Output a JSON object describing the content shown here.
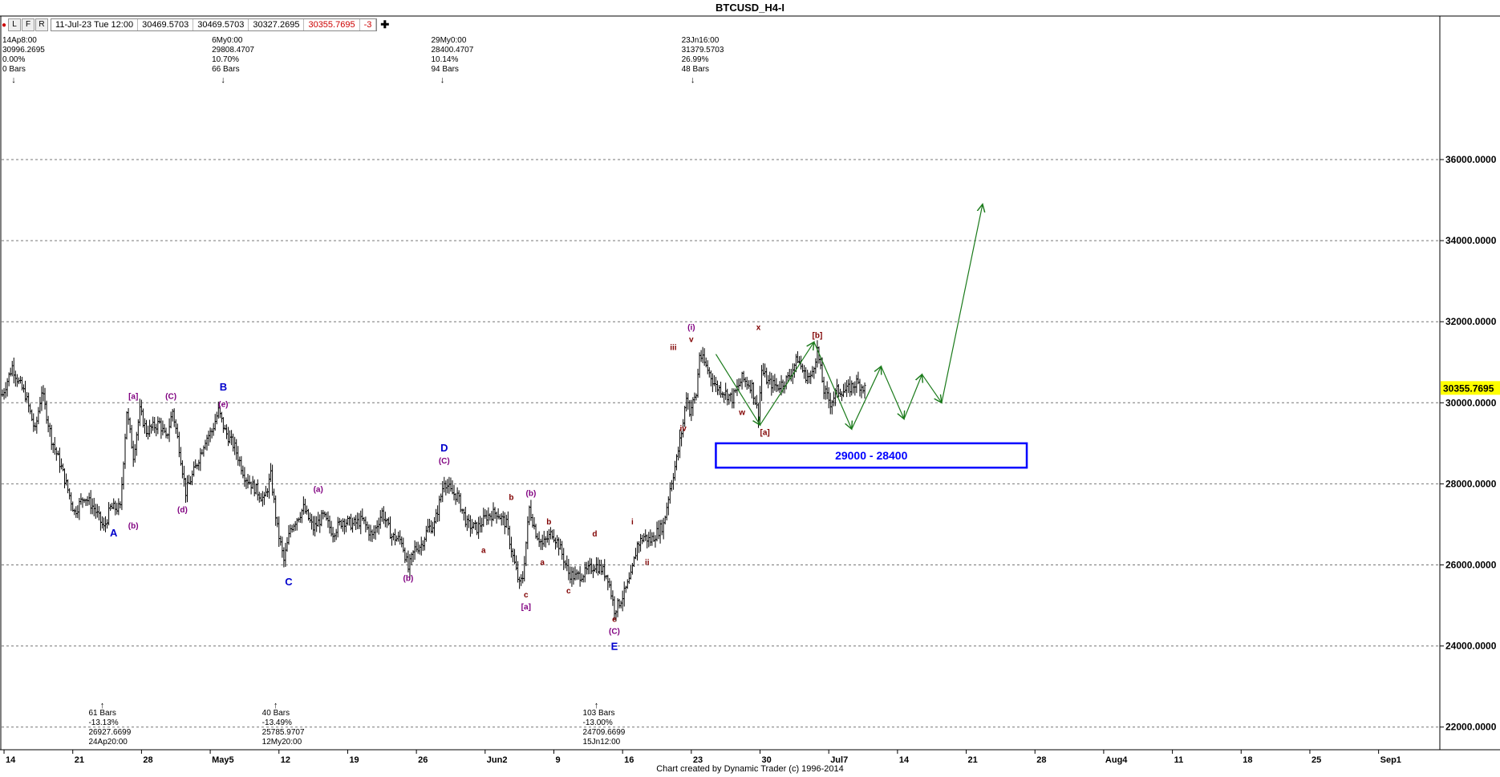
{
  "window": {
    "title": "BTCUSD_H4-I",
    "toolbar": {
      "buttons": [
        "L",
        "F",
        "R"
      ],
      "date": "11-Jul-23 Tue 12:00",
      "open": "30469.5703",
      "high": "30469.5703",
      "low": "30327.2695",
      "close": "30355.7695",
      "change": "-3"
    },
    "credit": "Chart created by Dynamic Trader  (c) 1996-2014"
  },
  "colors": {
    "up_arrow": "#1a7a1a",
    "target_box": "#0000ff",
    "wave_blue": "#0000cc",
    "wave_purple": "#800080",
    "wave_maroon": "#800000",
    "price_box": "#ffff00"
  },
  "chart_data": {
    "type": "ohlc",
    "title": "BTCUSD_H4-I",
    "ylim": [
      21500,
      37800
    ],
    "y_ticks": [
      22000,
      24000,
      26000,
      28000,
      30000,
      32000,
      34000,
      36000
    ],
    "y_tick_labels": [
      "22000.0000",
      "24000.0000",
      "26000.0000",
      "28000.0000",
      "30000.0000",
      "32000.0000",
      "34000.0000",
      "36000.0000"
    ],
    "x_ticks": [
      {
        "label": "14",
        "bar": 1
      },
      {
        "label": "21",
        "bar": 43
      },
      {
        "label": "28",
        "bar": 85
      },
      {
        "label": "May5",
        "bar": 127
      },
      {
        "label": "12",
        "bar": 169
      },
      {
        "label": "19",
        "bar": 211
      },
      {
        "label": "26",
        "bar": 253
      },
      {
        "label": "Jun2",
        "bar": 295
      },
      {
        "label": "9",
        "bar": 337
      },
      {
        "label": "16",
        "bar": 379
      },
      {
        "label": "23",
        "bar": 421
      },
      {
        "label": "30",
        "bar": 463
      },
      {
        "label": "Jul7",
        "bar": 505
      },
      {
        "label": "14",
        "bar": 547
      },
      {
        "label": "21",
        "bar": 589
      },
      {
        "label": "28",
        "bar": 631
      },
      {
        "label": "Aug4",
        "bar": 673
      },
      {
        "label": "11",
        "bar": 715
      },
      {
        "label": "18",
        "bar": 757
      },
      {
        "label": "25",
        "bar": 799
      },
      {
        "label": "Sep1",
        "bar": 841
      }
    ],
    "last_bar": 527,
    "current_price": "30355.7695",
    "path": [
      [
        0,
        30200
      ],
      [
        6,
        30900
      ],
      [
        10,
        30500
      ],
      [
        14,
        30200
      ],
      [
        20,
        29300
      ],
      [
        24,
        30300
      ],
      [
        30,
        29100
      ],
      [
        36,
        28400
      ],
      [
        44,
        27300
      ],
      [
        50,
        27700
      ],
      [
        56,
        27400
      ],
      [
        62,
        26900
      ],
      [
        66,
        27400
      ],
      [
        72,
        27400
      ],
      [
        76,
        29800
      ],
      [
        80,
        28700
      ],
      [
        84,
        29800
      ],
      [
        88,
        29300
      ],
      [
        96,
        29500
      ],
      [
        100,
        29100
      ],
      [
        104,
        29800
      ],
      [
        108,
        28900
      ],
      [
        112,
        27800
      ],
      [
        118,
        28400
      ],
      [
        124,
        29100
      ],
      [
        128,
        29300
      ],
      [
        132,
        29800
      ],
      [
        136,
        29300
      ],
      [
        142,
        28900
      ],
      [
        148,
        28200
      ],
      [
        154,
        27900
      ],
      [
        160,
        27600
      ],
      [
        164,
        28200
      ],
      [
        168,
        26900
      ],
      [
        172,
        26100
      ],
      [
        176,
        26900
      ],
      [
        184,
        27400
      ],
      [
        190,
        26900
      ],
      [
        196,
        27200
      ],
      [
        202,
        26800
      ],
      [
        208,
        27100
      ],
      [
        214,
        27000
      ],
      [
        220,
        27100
      ],
      [
        226,
        26700
      ],
      [
        232,
        27300
      ],
      [
        238,
        26700
      ],
      [
        244,
        26600
      ],
      [
        248,
        25900
      ],
      [
        252,
        26400
      ],
      [
        256,
        26500
      ],
      [
        260,
        26900
      ],
      [
        264,
        27000
      ],
      [
        268,
        27700
      ],
      [
        270,
        28100
      ],
      [
        274,
        27800
      ],
      [
        278,
        27700
      ],
      [
        284,
        27000
      ],
      [
        290,
        26900
      ],
      [
        296,
        27200
      ],
      [
        302,
        27300
      ],
      [
        308,
        27000
      ],
      [
        312,
        26200
      ],
      [
        316,
        25500
      ],
      [
        318,
        25700
      ],
      [
        322,
        27400
      ],
      [
        326,
        26800
      ],
      [
        330,
        26500
      ],
      [
        336,
        26800
      ],
      [
        340,
        26500
      ],
      [
        346,
        25800
      ],
      [
        350,
        25700
      ],
      [
        356,
        25800
      ],
      [
        362,
        26000
      ],
      [
        366,
        25900
      ],
      [
        370,
        25700
      ],
      [
        372,
        25300
      ],
      [
        374,
        24900
      ],
      [
        376,
        25000
      ],
      [
        380,
        25300
      ],
      [
        384,
        25700
      ],
      [
        388,
        26500
      ],
      [
        392,
        26700
      ],
      [
        396,
        26600
      ],
      [
        400,
        26800
      ],
      [
        404,
        27000
      ],
      [
        408,
        27900
      ],
      [
        412,
        28600
      ],
      [
        416,
        29500
      ],
      [
        418,
        30200
      ],
      [
        420,
        29800
      ],
      [
        424,
        30200
      ],
      [
        426,
        31200
      ],
      [
        430,
        30900
      ],
      [
        436,
        30400
      ],
      [
        440,
        30300
      ],
      [
        446,
        30100
      ],
      [
        452,
        30600
      ],
      [
        458,
        30400
      ],
      [
        462,
        29700
      ],
      [
        464,
        30800
      ],
      [
        468,
        30500
      ],
      [
        474,
        30400
      ],
      [
        480,
        30600
      ],
      [
        486,
        31100
      ],
      [
        490,
        30700
      ],
      [
        494,
        30600
      ],
      [
        498,
        31300
      ],
      [
        502,
        30300
      ],
      [
        506,
        30000
      ],
      [
        510,
        30300
      ],
      [
        516,
        30300
      ],
      [
        522,
        30500
      ],
      [
        527,
        30355
      ]
    ],
    "projection": [
      [
        436,
        31200
      ],
      [
        463,
        29450
      ],
      [
        496,
        31500
      ],
      [
        519,
        29350
      ],
      [
        537,
        30900
      ],
      [
        551,
        29600
      ],
      [
        562,
        30700
      ],
      [
        574,
        30000
      ],
      [
        599,
        34900
      ]
    ],
    "target_box": {
      "label": "29000 - 28400",
      "from_bar": 436,
      "to_bar": 626,
      "high": 29000,
      "low": 28400
    },
    "wave_labels": [
      {
        "text": "A",
        "bar": 68,
        "price": 26700,
        "color": "blue"
      },
      {
        "text": "B",
        "bar": 135,
        "price": 30300,
        "color": "blue"
      },
      {
        "text": "C",
        "bar": 175,
        "price": 25500,
        "color": "blue"
      },
      {
        "text": "D",
        "bar": 270,
        "price": 28800,
        "color": "blue"
      },
      {
        "text": "E",
        "bar": 374,
        "price": 23900,
        "color": "blue"
      },
      {
        "text": "[a]",
        "bar": 80,
        "price": 30100,
        "color": "purple"
      },
      {
        "text": "(b)",
        "bar": 80,
        "price": 26900,
        "color": "purple"
      },
      {
        "text": "(C)",
        "bar": 103,
        "price": 30100,
        "color": "purple"
      },
      {
        "text": "(d)",
        "bar": 110,
        "price": 27300,
        "color": "purple"
      },
      {
        "text": "(e)",
        "bar": 135,
        "price": 29900,
        "color": "purple"
      },
      {
        "text": "(a)",
        "bar": 193,
        "price": 27800,
        "color": "purple"
      },
      {
        "text": "(b)",
        "bar": 248,
        "price": 25600,
        "color": "purple"
      },
      {
        "text": "(C)",
        "bar": 270,
        "price": 28500,
        "color": "purple"
      },
      {
        "text": "(b)",
        "bar": 323,
        "price": 27700,
        "color": "purple"
      },
      {
        "text": "[a]",
        "bar": 320,
        "price": 24900,
        "color": "purple"
      },
      {
        "text": "(C)",
        "bar": 374,
        "price": 24300,
        "color": "purple"
      },
      {
        "text": "(i)",
        "bar": 421,
        "price": 31800,
        "color": "purple"
      },
      {
        "text": "b",
        "bar": 311,
        "price": 27600,
        "color": "maroon"
      },
      {
        "text": "a",
        "bar": 294,
        "price": 26300,
        "color": "maroon"
      },
      {
        "text": "c",
        "bar": 320,
        "price": 25200,
        "color": "maroon"
      },
      {
        "text": "a",
        "bar": 330,
        "price": 26000,
        "color": "maroon"
      },
      {
        "text": "b",
        "bar": 334,
        "price": 27000,
        "color": "maroon"
      },
      {
        "text": "c",
        "bar": 346,
        "price": 25300,
        "color": "maroon"
      },
      {
        "text": "d",
        "bar": 362,
        "price": 26700,
        "color": "maroon"
      },
      {
        "text": "e",
        "bar": 374,
        "price": 24600,
        "color": "maroon"
      },
      {
        "text": "i",
        "bar": 385,
        "price": 27000,
        "color": "maroon"
      },
      {
        "text": "ii",
        "bar": 394,
        "price": 26000,
        "color": "maroon"
      },
      {
        "text": "iii",
        "bar": 410,
        "price": 31300,
        "color": "maroon"
      },
      {
        "text": "iv",
        "bar": 416,
        "price": 29300,
        "color": "maroon"
      },
      {
        "text": "v",
        "bar": 421,
        "price": 31500,
        "color": "maroon"
      },
      {
        "text": "x",
        "bar": 462,
        "price": 31800,
        "color": "maroon"
      },
      {
        "text": "w",
        "bar": 452,
        "price": 29700,
        "color": "maroon"
      },
      {
        "text": "[a]",
        "bar": 466,
        "price": 29200,
        "color": "maroon"
      },
      {
        "text": "[b]",
        "bar": 498,
        "price": 31600,
        "color": "maroon"
      }
    ],
    "top_annotations": [
      {
        "bar": 0,
        "lines": [
          "14Ap8:00",
          "30996.2695",
          "0.00%",
          "0 Bars"
        ]
      },
      {
        "bar": 128,
        "lines": [
          "6My0:00",
          "29808.4707",
          "10.70%",
          "66 Bars"
        ]
      },
      {
        "bar": 262,
        "lines": [
          "29My0:00",
          "28400.4707",
          "10.14%",
          "94 Bars"
        ]
      },
      {
        "bar": 415,
        "lines": [
          "23Jn16:00",
          "31379.5703",
          "26.99%",
          "48 Bars"
        ]
      }
    ],
    "bottom_annotations": [
      {
        "bar": 61,
        "lines": [
          "61 Bars",
          "-13.13%",
          "26927.6699",
          "24Ap20:00"
        ]
      },
      {
        "bar": 167,
        "lines": [
          "40 Bars",
          "-13.49%",
          "25785.9707",
          "12My20:00"
        ]
      },
      {
        "bar": 363,
        "lines": [
          "103 Bars",
          "-13.00%",
          "24709.6699",
          "15Jn12:00"
        ]
      }
    ]
  }
}
